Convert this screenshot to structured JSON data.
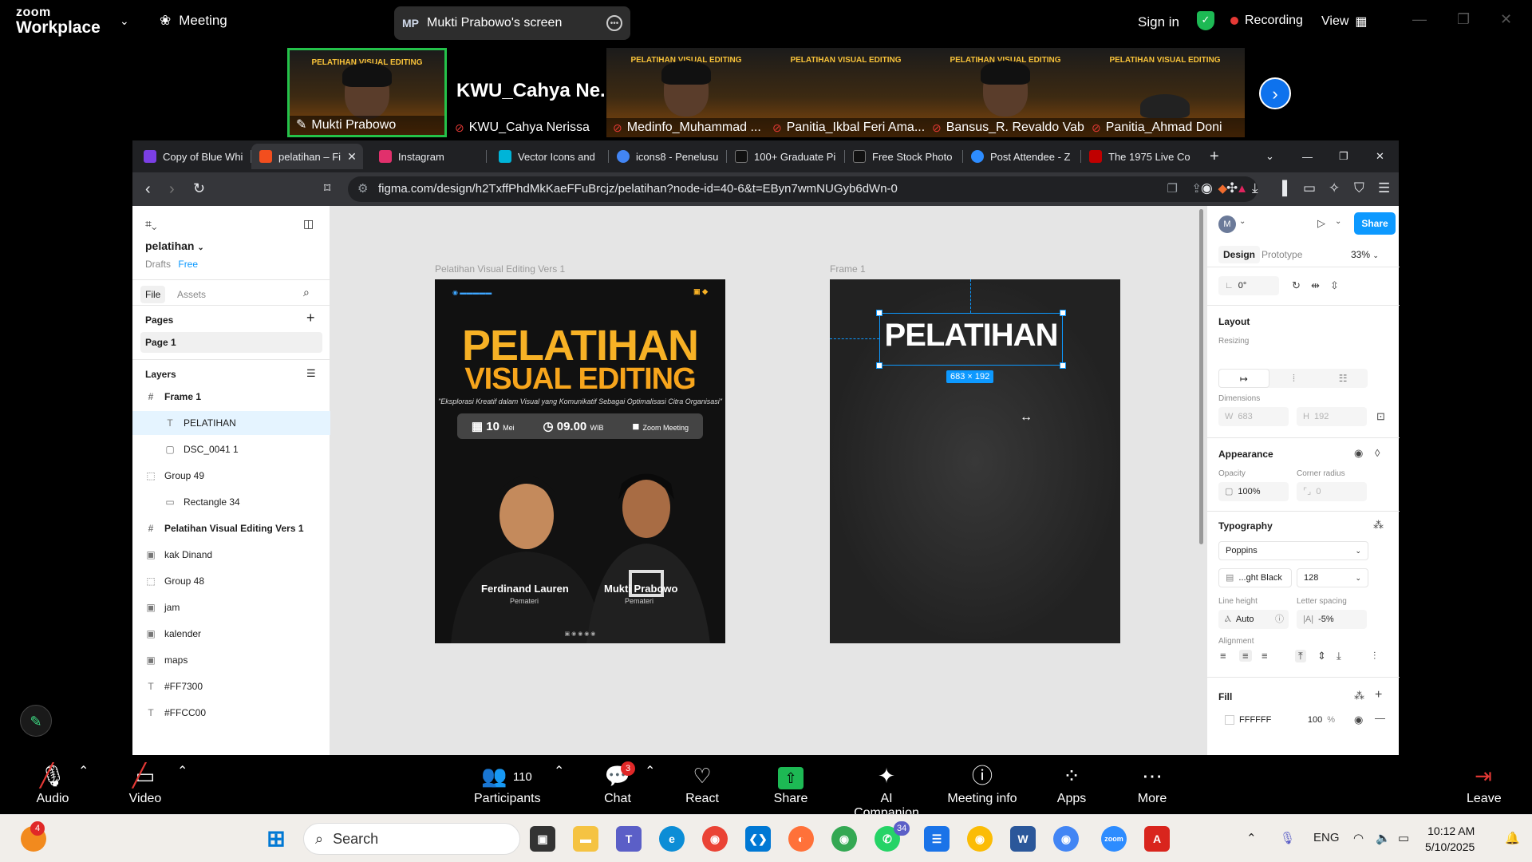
{
  "zoom_top": {
    "logo_line1": "zoom",
    "logo_line2": "Workplace",
    "meeting_label": "Meeting",
    "screen_initials": "MP",
    "screen_label": "Mukti Prabowo's screen",
    "sign_in": "Sign in",
    "recording": "Recording",
    "view": "View"
  },
  "participants": [
    {
      "name": "Mukti Prabowo",
      "active": true
    },
    {
      "name": "KWU_Cahya Nerissa",
      "bigname": "KWU_Cahya  Ne..."
    },
    {
      "name": "Medinfo_Muhammad ..."
    },
    {
      "name": "Panitia_Ikbal Feri Ama..."
    },
    {
      "name": "Bansus_R. Revaldo Vab..."
    },
    {
      "name": "Panitia_Ahmad Doni"
    }
  ],
  "tile_banner": "PELATIHAN VISUAL EDITING",
  "browser": {
    "tabs": [
      {
        "label": "Copy of Blue Whi",
        "color": "#7b3fe4"
      },
      {
        "label": "pelatihan – Fi",
        "color": "#f24e1e",
        "active": true
      },
      {
        "label": "Instagram",
        "color": "#e1306c"
      },
      {
        "label": "Vector Icons and",
        "color": "#00b4d8"
      },
      {
        "label": "icons8 - Penelusu",
        "color": "#4285f4"
      },
      {
        "label": "100+ Graduate Pi",
        "color": "#111111"
      },
      {
        "label": "Free Stock Photo",
        "color": "#111111"
      },
      {
        "label": "Post Attendee - Z",
        "color": "#2d8cff"
      },
      {
        "label": "The 1975 Live Co",
        "color": "#c00000"
      }
    ],
    "url": "figma.com/design/h2TxffPhdMkKaeFFuBrcjz/pelatihan?node-id=40-6&t=EByn7wmNUGyb6dWn-0"
  },
  "figma_left": {
    "file_name": "pelatihan",
    "drafts": "Drafts",
    "plan": "Free",
    "tab_file": "File",
    "tab_assets": "Assets",
    "pages_heading": "Pages",
    "page1": "Page 1",
    "layers_heading": "Layers",
    "layers": [
      {
        "name": "Frame 1",
        "icon": "#",
        "bold": true
      },
      {
        "name": "PELATIHAN",
        "icon": "T",
        "child": true,
        "selected": true
      },
      {
        "name": "DSC_0041 1",
        "icon": "▢",
        "child": true
      },
      {
        "name": "Group 49",
        "icon": "⬚"
      },
      {
        "name": "Rectangle 34",
        "icon": "▭",
        "child": true
      },
      {
        "name": "Pelatihan Visual Editing Vers 1",
        "icon": "#",
        "bold": true
      },
      {
        "name": "kak Dinand",
        "icon": "▣"
      },
      {
        "name": "Group 48",
        "icon": "⬚"
      },
      {
        "name": "jam",
        "icon": "▣"
      },
      {
        "name": "kalender",
        "icon": "▣"
      },
      {
        "name": "maps",
        "icon": "▣"
      },
      {
        "name": "#FF7300",
        "icon": "T"
      },
      {
        "name": "#FFCC00",
        "icon": "T"
      }
    ]
  },
  "canvas": {
    "frame_label_1": "Pelatihan Visual Editing Vers 1",
    "frame_label_2": "Frame 1",
    "poster_line1": "PELATIHAN",
    "poster_line2": "VISUAL EDITING",
    "poster_sub": "\"Eksplorasi Kreatif dalam Visual yang Komunikatif Sebagai Optimalisasi Citra Organisasi\"",
    "poster_date": "10",
    "poster_month": "Mei",
    "poster_time": "09.00",
    "poster_tz": "WIB",
    "poster_zoom": "Zoom Meeting",
    "speaker1": "Ferdinand Lauren",
    "speaker2": "Mukti Prabowo",
    "speaker_role": "Pemateri",
    "selected_text": "PELATIHAN",
    "dimension_badge": "683 × 192"
  },
  "figma_right": {
    "avatar": "M",
    "share": "Share",
    "tab_design": "Design",
    "tab_prototype": "Prototype",
    "zoom": "33%",
    "rotation": "0°",
    "layout_heading": "Layout",
    "resizing": "Resizing",
    "dimensions": "Dimensions",
    "w_label": "W",
    "w_value": "683",
    "h_label": "H",
    "h_value": "192",
    "appearance_heading": "Appearance",
    "opacity_label": "Opacity",
    "opacity_value": "100%",
    "corner_label": "Corner radius",
    "corner_value": "0",
    "typography_heading": "Typography",
    "font_family": "Poppins",
    "font_weight": "...ght Black",
    "font_size": "128",
    "line_height_label": "Line height",
    "line_height_value": "Auto",
    "letter_spacing_label": "Letter spacing",
    "letter_spacing_value": "-5%",
    "alignment_label": "Alignment",
    "fill_heading": "Fill",
    "fill_hex": "FFFFFF",
    "fill_opacity": "100",
    "fill_pct": "%"
  },
  "zoom_bottom": {
    "audio": "Audio",
    "video": "Video",
    "participants_count": "110",
    "participants": "Participants",
    "chat": "Chat",
    "chat_badge": "3",
    "react": "React",
    "share": "Share",
    "ai": "AI Companion",
    "meeting_info": "Meeting info",
    "apps": "Apps",
    "more": "More",
    "leave": "Leave"
  },
  "taskbar": {
    "search": "Search",
    "notif_badge": "4",
    "whatsapp_badge": "34",
    "lang": "ENG",
    "time": "10:12 AM",
    "date": "5/10/2025"
  }
}
